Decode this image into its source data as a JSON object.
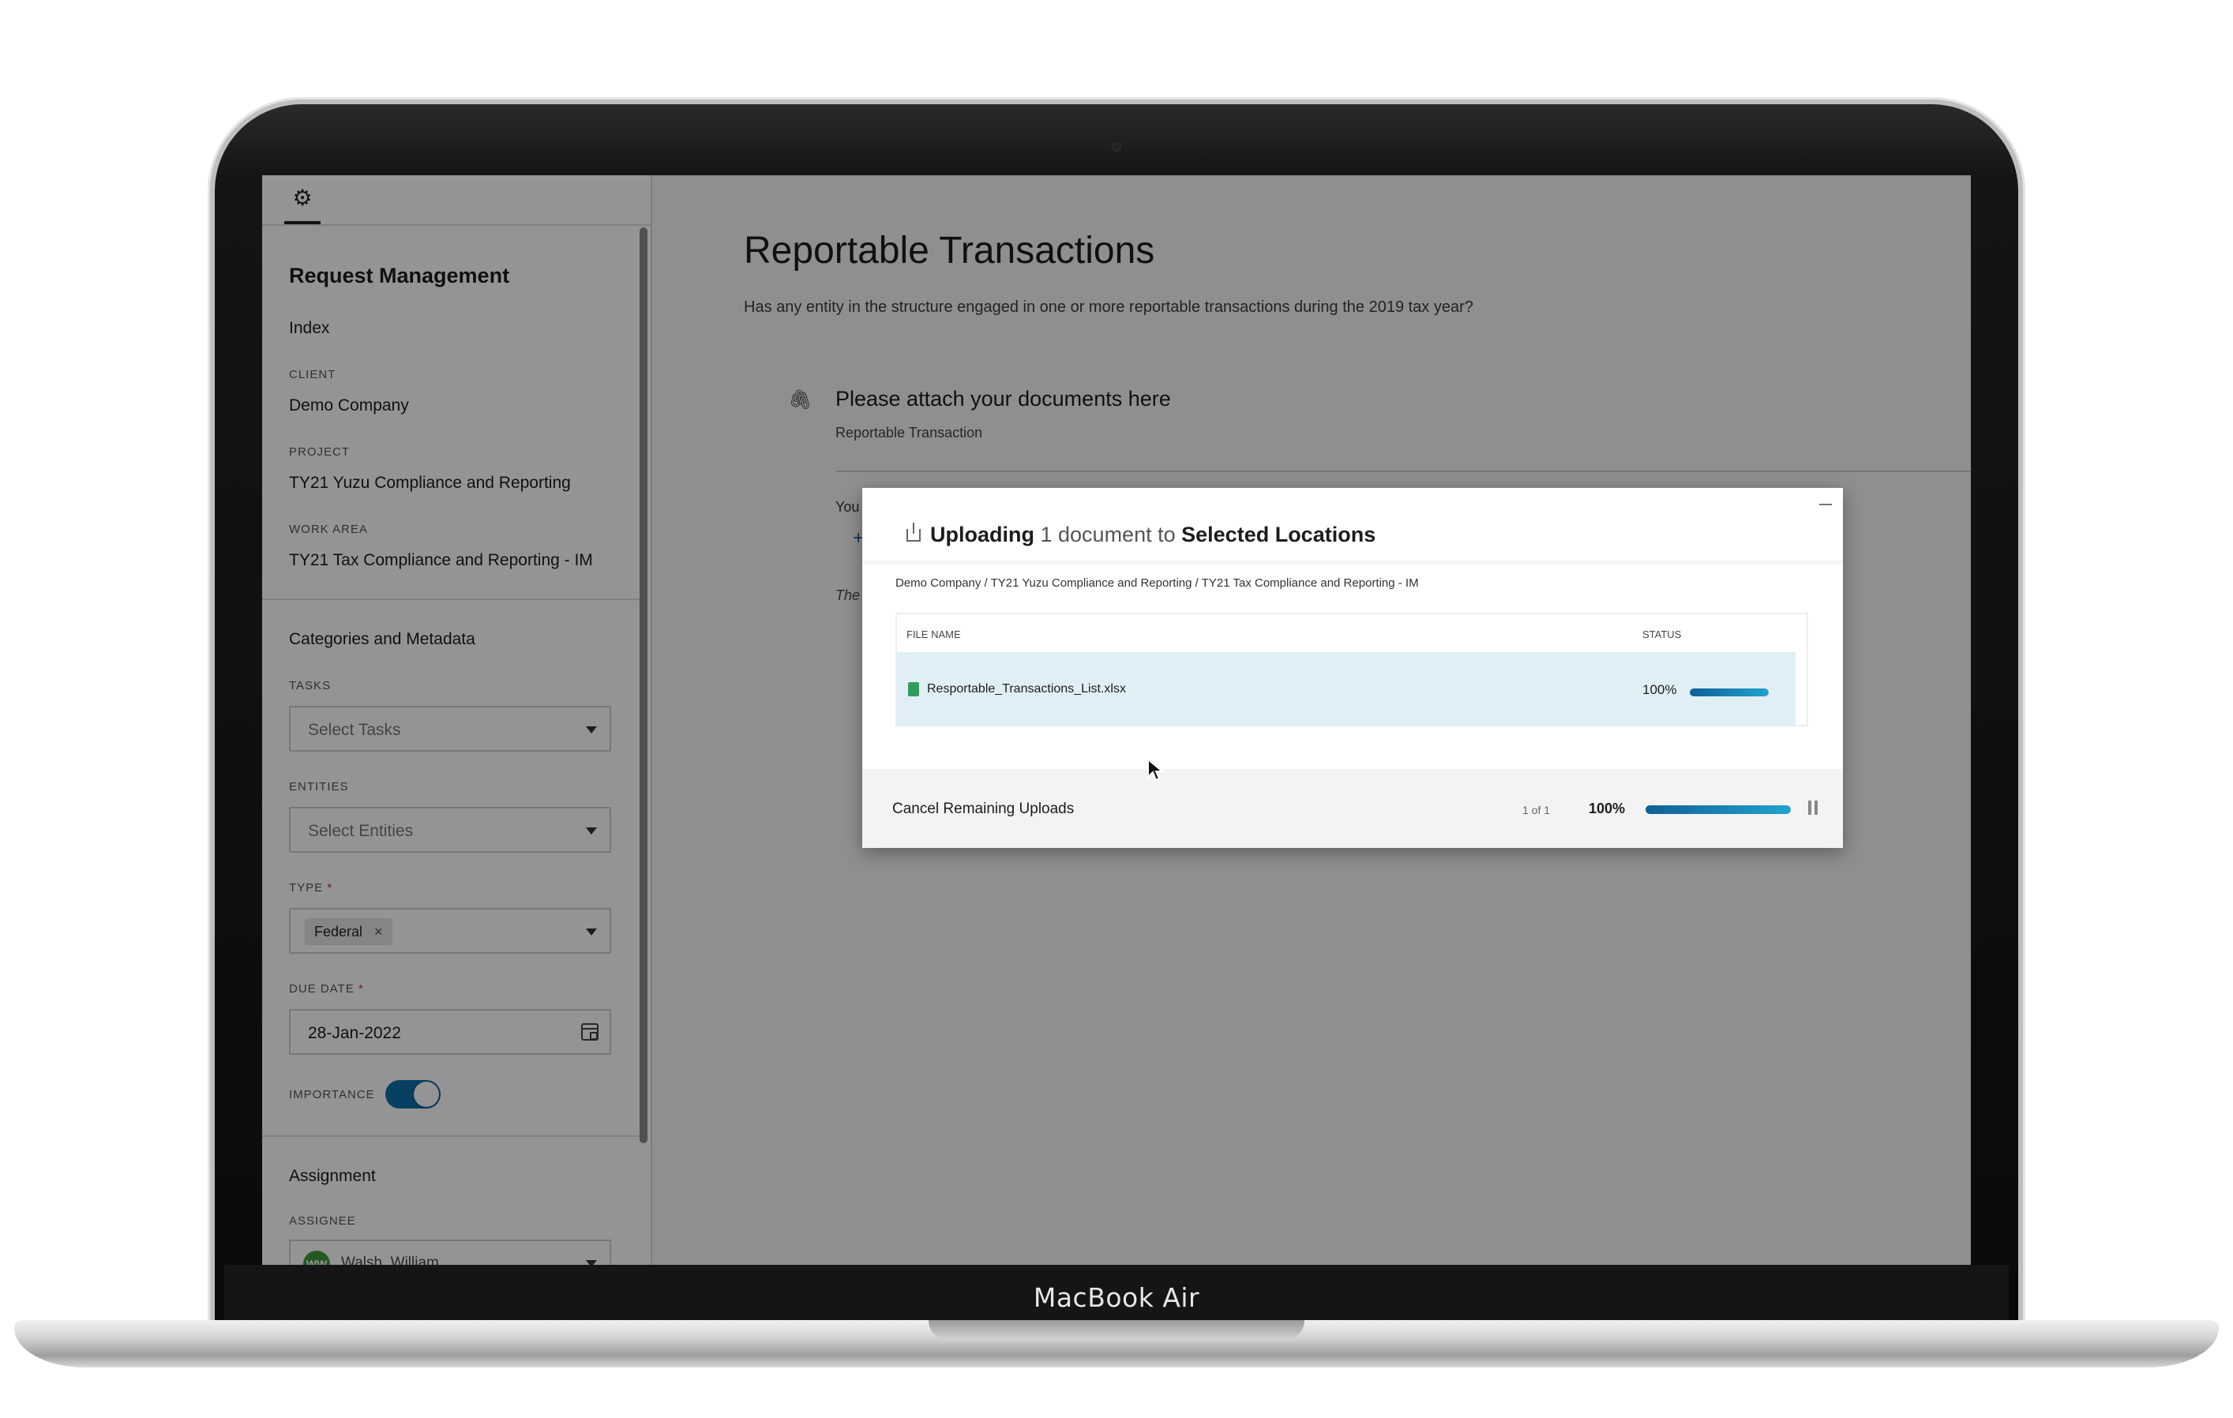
{
  "device": {
    "label": "MacBook Air"
  },
  "sidebar": {
    "title": "Request Management",
    "index_label": "Index",
    "client_label": "CLIENT",
    "client_value": "Demo Company",
    "project_label": "PROJECT",
    "project_value": "TY21 Yuzu Compliance and Reporting",
    "work_area_label": "WORK AREA",
    "work_area_value": "TY21 Tax Compliance and Reporting - IM",
    "categories_title": "Categories and Metadata",
    "tasks_label": "TASKS",
    "tasks_placeholder": "Select Tasks",
    "entities_label": "ENTITIES",
    "entities_placeholder": "Select Entities",
    "type_label": "TYPE",
    "type_chip": "Federal",
    "chip_remove": "×",
    "due_date_label": "DUE DATE",
    "due_date_value": "28-Jan-2022",
    "importance_label": "IMPORTANCE",
    "importance_on": true,
    "required_marker": "*",
    "assignment_title": "Assignment",
    "assignee_label": "ASSIGNEE",
    "assignee_initials": "WW",
    "assignee_name": "Walsh, William",
    "gear_icon": "gear-icon"
  },
  "main": {
    "title": "Reportable Transactions",
    "subtitle": "Has any entity in the structure engaged in one or more reportable transactions during the 2019 tax year?",
    "attach_title": "Please attach your documents here",
    "attach_subtitle": "Reportable Transaction",
    "ghost_you": "You",
    "ghost_plus": "+",
    "ghost_the": "The"
  },
  "modal": {
    "header_uploading": "Uploading",
    "header_count": "1 document to",
    "header_destination": "Selected Locations",
    "path": "Demo Company / TY21 Yuzu Compliance and Reporting / TY21 Tax Compliance and Reporting - IM",
    "col_file_name": "FILE NAME",
    "col_status": "STATUS",
    "files": [
      {
        "name": "Resportable_Transactions_List.xlsx",
        "progress_label": "100%",
        "progress": 100
      }
    ],
    "cancel_label": "Cancel Remaining Uploads",
    "count_label": "1 of 1",
    "total_progress_label": "100%",
    "total_progress": 100
  },
  "colors": {
    "accent": "#0e6ea8",
    "progress_start": "#0f5f96",
    "progress_end": "#21a4cf",
    "file_icon": "#2e9e5a",
    "row_highlight": "#e0eff6"
  }
}
